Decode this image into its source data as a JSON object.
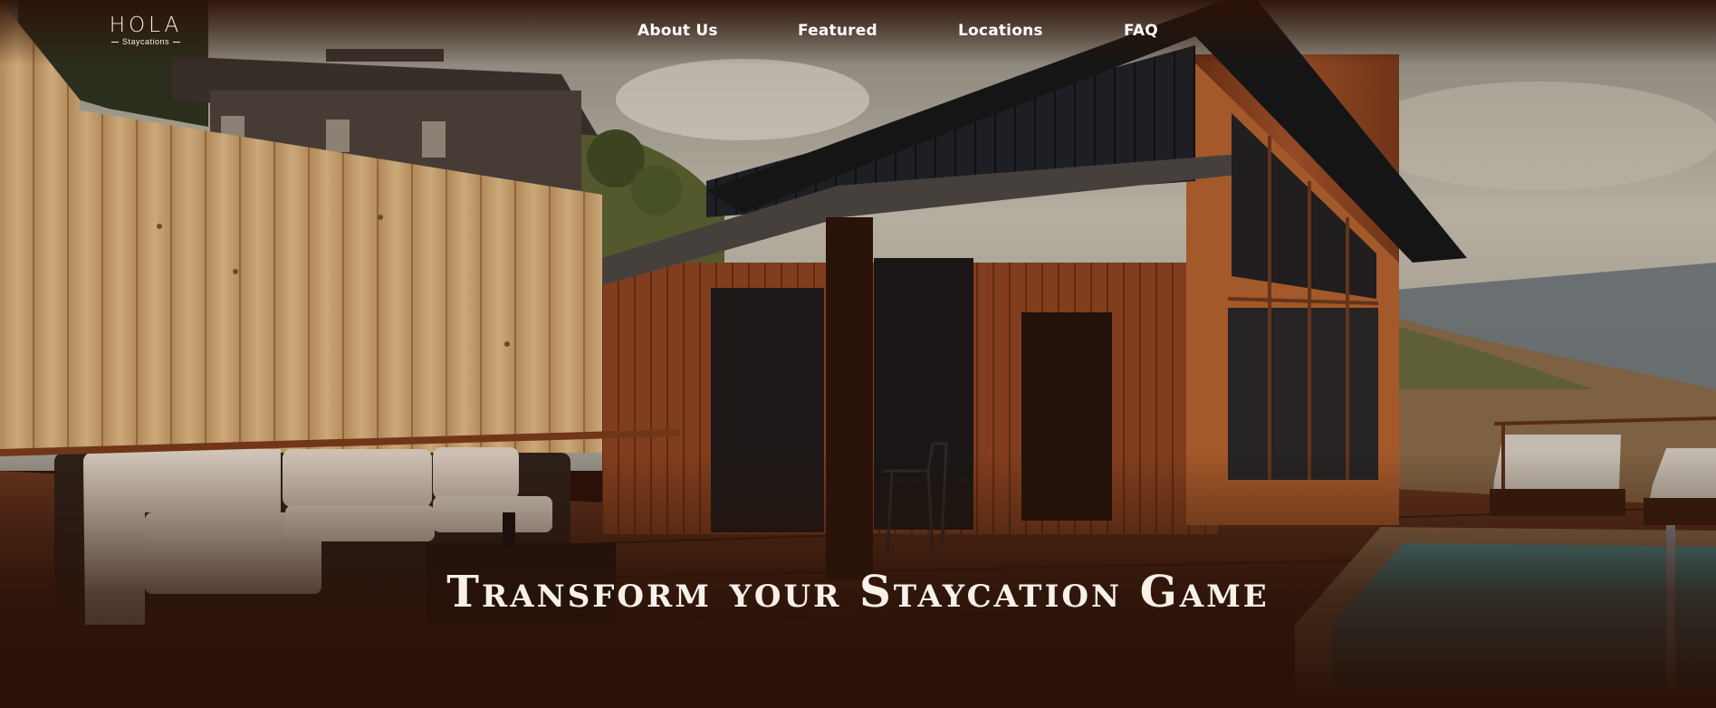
{
  "brand": {
    "name": "HOLA",
    "tagline": "Staycations"
  },
  "nav": {
    "items": [
      {
        "label": "About Us"
      },
      {
        "label": "Featured"
      },
      {
        "label": "Locations"
      },
      {
        "label": "FAQ"
      }
    ]
  },
  "hero": {
    "headline": "Transform your Staycation Game"
  },
  "colors": {
    "overlay": "#2a1208",
    "text": "#ffffff",
    "wood": "#b8642f",
    "fence": "#d8b07a"
  }
}
